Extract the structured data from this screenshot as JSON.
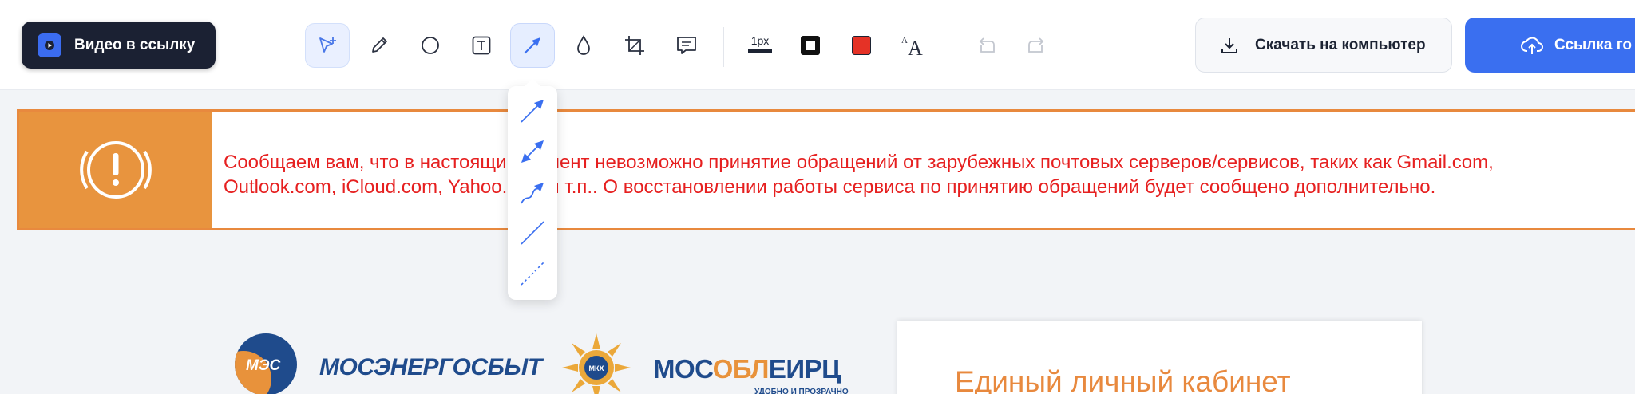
{
  "toolbar": {
    "video_button_label": "Видео в ссылку",
    "line_width_label": "1px",
    "stroke_color": "#111111",
    "fill_color": "#e53226",
    "download_label": "Скачать на компьютер",
    "link_label": "Ссылка го",
    "tools": [
      {
        "icon": "select-plus-icon"
      },
      {
        "icon": "pencil-icon"
      },
      {
        "icon": "circle-icon"
      },
      {
        "icon": "text-icon"
      },
      {
        "icon": "arrow-icon",
        "active": true
      },
      {
        "icon": "blur-drop-icon"
      },
      {
        "icon": "crop-icon"
      },
      {
        "icon": "comment-icon"
      },
      {
        "icon": "line-width-icon"
      },
      {
        "icon": "stroke-color-icon"
      },
      {
        "icon": "fill-color-icon"
      },
      {
        "icon": "font-size-icon"
      },
      {
        "icon": "undo-icon"
      },
      {
        "icon": "redo-icon"
      }
    ]
  },
  "arrow_menu": {
    "items": [
      "arrow-end-icon",
      "arrow-double-icon",
      "arrow-curved-icon",
      "line-solid-icon",
      "line-dashed-icon"
    ]
  },
  "banner": {
    "line1": "Сообщаем вам, что в настоящий момент невозможно принятие обращений от зарубежных почтовых серверов/сервисов, таких как Gmail.com,",
    "line2": "Outlook.com, iCloud.com, Yahoo.com и т.п.. О восстановлении работы сервиса по принятию обращений будет сообщено дополнительно."
  },
  "logos": {
    "mes_abbr": "МЭС",
    "mes_name": "МОСЭНЕРГОСБЫТ",
    "mkhk": "МКХ",
    "mosobl_a": "МОС",
    "mosobl_b": "ОБЛ",
    "mosobl_c": "ЕИРЦ",
    "tagline": "УДОБНО И ПРОЗРАЧНО"
  },
  "card": {
    "title": "Единый личный кабинет"
  }
}
